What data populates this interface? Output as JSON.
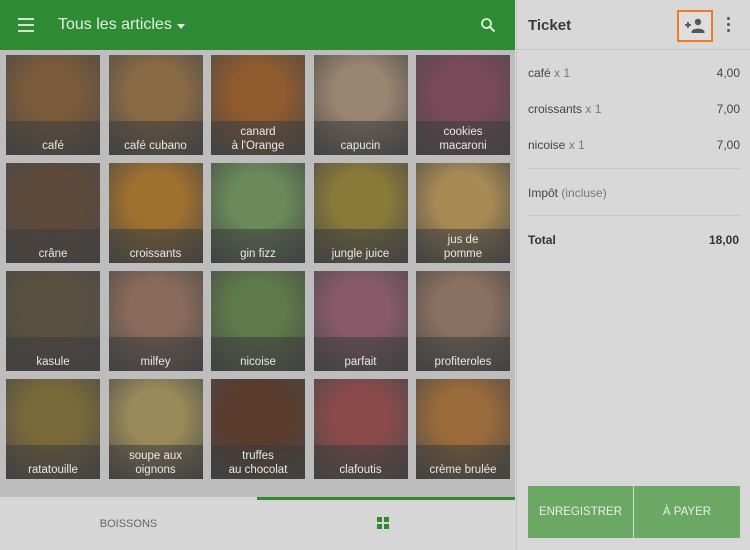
{
  "header": {
    "menu_icon": "hamburger-icon",
    "category": "Tous les articles",
    "search_icon": "search-icon",
    "bar_color": "#2e8b33"
  },
  "items": [
    {
      "label": "café",
      "photo": "#7a5a3a"
    },
    {
      "label": "café cubano",
      "photo": "#8a6a45"
    },
    {
      "label": "canard\nà l'Orange",
      "photo": "#8f5a2e"
    },
    {
      "label": "capucin",
      "photo": "#9a8570"
    },
    {
      "label": "cookies\nmacaroni",
      "photo": "#7a4a5a"
    },
    {
      "label": "crâne",
      "photo": "#5e4a3a"
    },
    {
      "label": "croissants",
      "photo": "#a0702e"
    },
    {
      "label": "gin fizz",
      "photo": "#6a8a5a"
    },
    {
      "label": "jungle juice",
      "photo": "#8a7a3a"
    },
    {
      "label": "jus de\npomme",
      "photo": "#a88a55"
    },
    {
      "label": "kasule",
      "photo": "#5a5040"
    },
    {
      "label": "milfey",
      "photo": "#8a6a5a"
    },
    {
      "label": "nicoise",
      "photo": "#5f7a4a"
    },
    {
      "label": "parfait",
      "photo": "#8a5a6a"
    },
    {
      "label": "profiteroles",
      "photo": "#8a7060"
    },
    {
      "label": "ratatouille",
      "photo": "#7a6a3a"
    },
    {
      "label": "soupe aux\noignons",
      "photo": "#9a8a5a"
    },
    {
      "label": "truffes\nau chocolat",
      "photo": "#5a3a2a"
    },
    {
      "label": "clafoutis",
      "photo": "#8a4a4a"
    },
    {
      "label": "crème brulée",
      "photo": "#9a6a3a"
    }
  ],
  "tabs": {
    "boissons": "BOISSONS",
    "grid_icon": "grid-icon"
  },
  "ticket": {
    "title": "Ticket",
    "add_customer_icon": "add-customer-icon",
    "more_icon": "more-vert-icon",
    "lines": [
      {
        "name": "café",
        "qty": "x 1",
        "price": "4,00"
      },
      {
        "name": "croissants",
        "qty": "x 1",
        "price": "7,00"
      },
      {
        "name": "nicoise",
        "qty": "x 1",
        "price": "7,00"
      }
    ],
    "tax_label": "Impôt",
    "tax_note": "(incluse)",
    "total_label": "Total",
    "total_value": "18,00",
    "save_button": "ENREGISTRER",
    "pay_button": "À PAYER",
    "highlight_color": "#f07a22"
  }
}
